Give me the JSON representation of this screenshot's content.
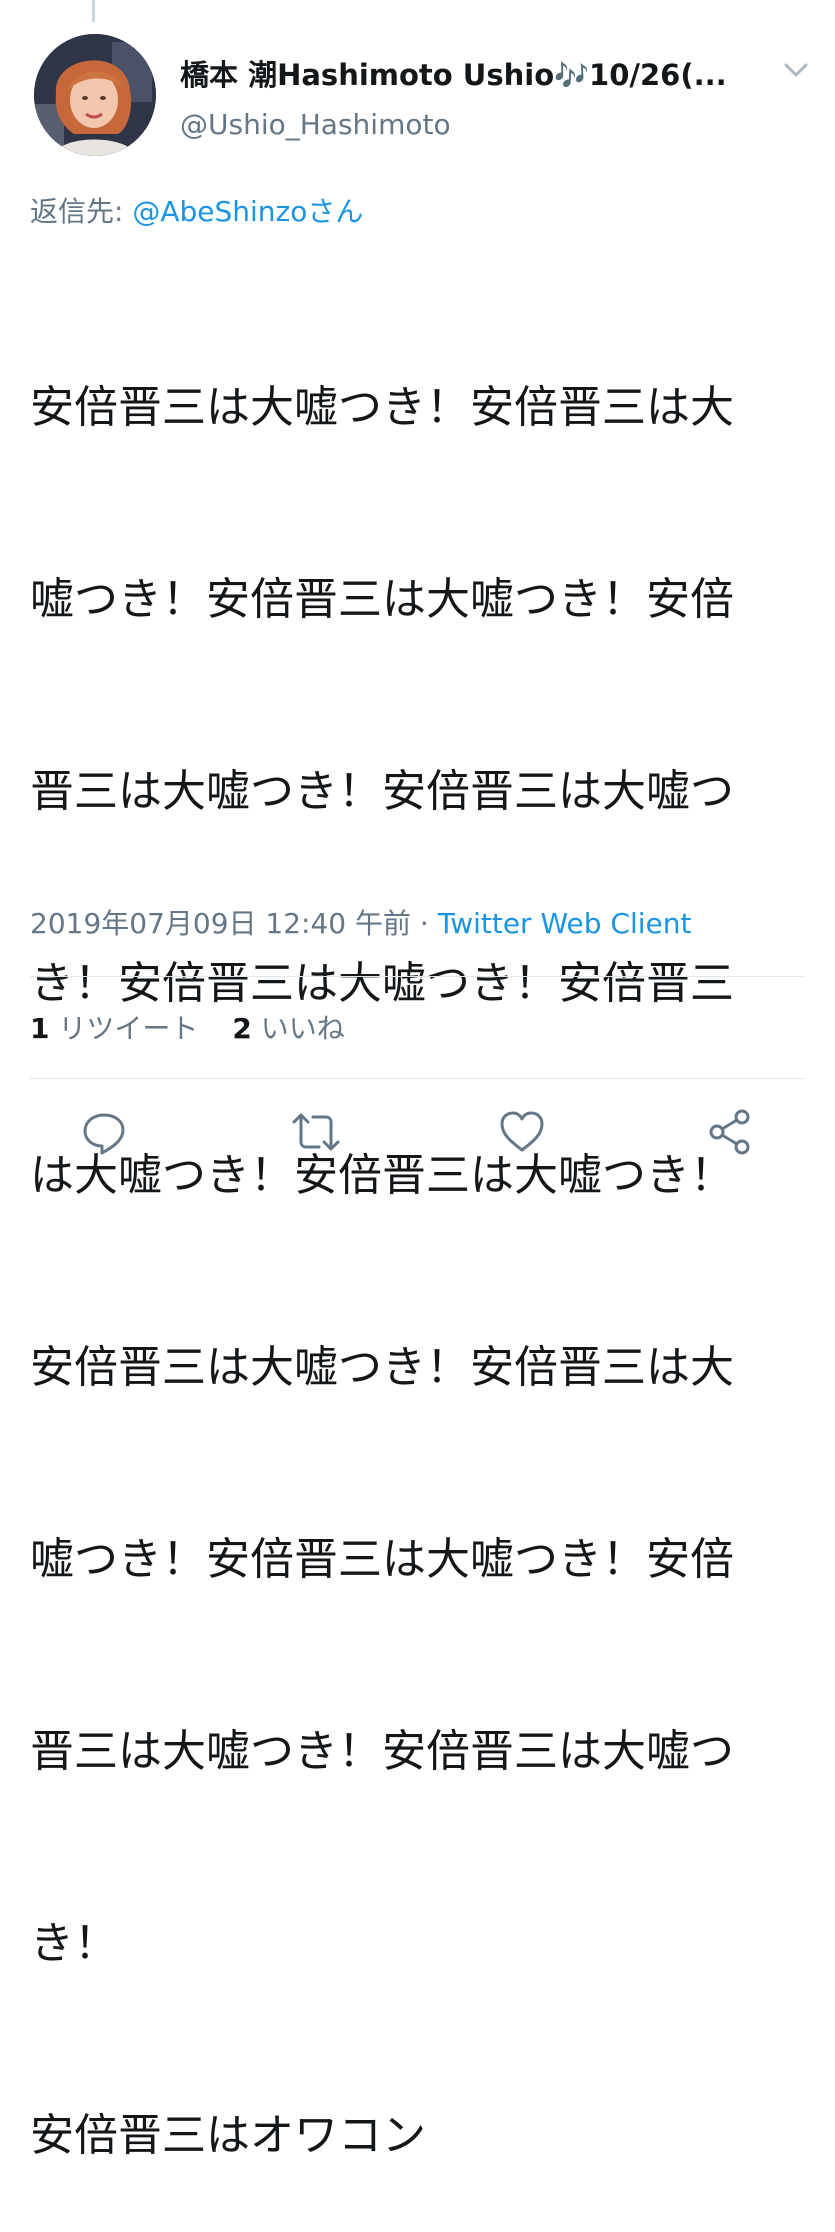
{
  "tweet": {
    "author": {
      "display_name": "橋本 潮Hashimoto Ushio",
      "name_emoji": "🎶",
      "name_suffix": "10/26(...",
      "username": "@Ushio_Hashimoto"
    },
    "reply": {
      "prefix": "返信先: ",
      "handle": "@AbeShinzoさん"
    },
    "text_lines": [
      "安倍晋三は大嘘つき！安倍晋三は大",
      "嘘つき！安倍晋三は大嘘つき！安倍",
      "晋三は大嘘つき！安倍晋三は大嘘つ",
      "き！安倍晋三は大嘘つき！安倍晋三",
      "は大嘘つき！安倍晋三は大嘘つき！",
      "安倍晋三は大嘘つき！安倍晋三は大",
      "嘘つき！安倍晋三は大嘘つき！安倍",
      "晋三は大嘘つき！安倍晋三は大嘘つ",
      "き！",
      "安倍晋三はオワコン"
    ],
    "timestamp": "2019年07月09日 12:40 午前",
    "separator": " · ",
    "client": "Twitter Web Client",
    "stats": {
      "retweets_count": "1",
      "retweets_label": " リツイート",
      "likes_count": "2",
      "likes_label": " いいね"
    }
  },
  "icons": {
    "caret": "chevron-down-icon",
    "reply": "reply-icon",
    "retweet": "retweet-icon",
    "like": "heart-icon",
    "share": "share-icon"
  },
  "colors": {
    "link": "#1b95e0",
    "secondary_text": "#657786",
    "primary_text": "#14171a",
    "divider": "#e1e8ed"
  }
}
